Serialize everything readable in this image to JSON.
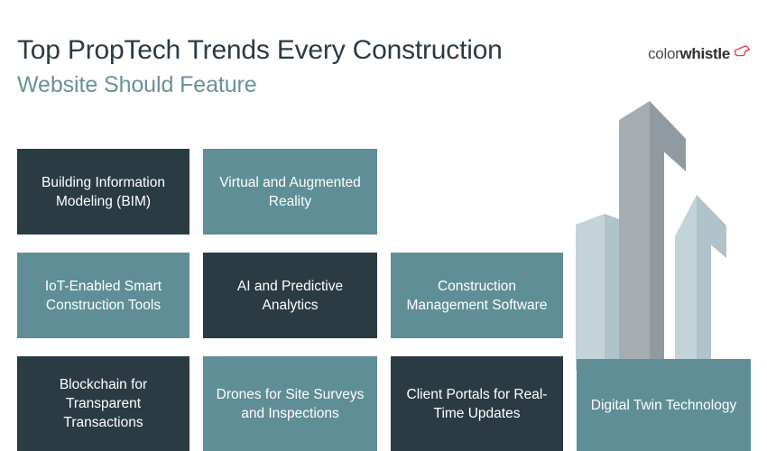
{
  "header": {
    "title_line1": "Top PropTech Trends Every Construction",
    "title_line2": "Website Should Feature"
  },
  "logo": {
    "text_light": "color",
    "text_bold": "whistle",
    "mark_name": "whistle-icon",
    "mark_color": "#e0434b"
  },
  "colors": {
    "dark": "#2b3b44",
    "teal": "#5f8e96",
    "subtitle": "#6b9099",
    "building_gray": "#a5adb2",
    "building_gray_dark": "#919aa0",
    "building_light": "#c3d3d8",
    "building_light_dark": "#b0c3ca",
    "background": "#ffffff"
  },
  "cards": [
    {
      "label": "Building Information Modeling (BIM)",
      "style": "dark",
      "name": "card-bim"
    },
    {
      "label": "Virtual and Augmented Reality",
      "style": "teal",
      "name": "card-ar-vr"
    },
    {
      "label": "IoT-Enabled Smart Construction Tools",
      "style": "teal",
      "name": "card-iot"
    },
    {
      "label": "AI and Predictive Analytics",
      "style": "dark",
      "name": "card-ai"
    },
    {
      "label": "Construction Management Software",
      "style": "teal",
      "name": "card-management-software"
    },
    {
      "label": "Blockchain for Transparent Transactions",
      "style": "dark",
      "name": "card-blockchain"
    },
    {
      "label": "Drones for Site Surveys and Inspections",
      "style": "teal",
      "name": "card-drones"
    },
    {
      "label": "Client Portals for Real-Time Updates",
      "style": "dark",
      "name": "card-client-portals"
    },
    {
      "label": "Digital Twin Technology",
      "style": "teal",
      "name": "card-digital-twin"
    }
  ]
}
